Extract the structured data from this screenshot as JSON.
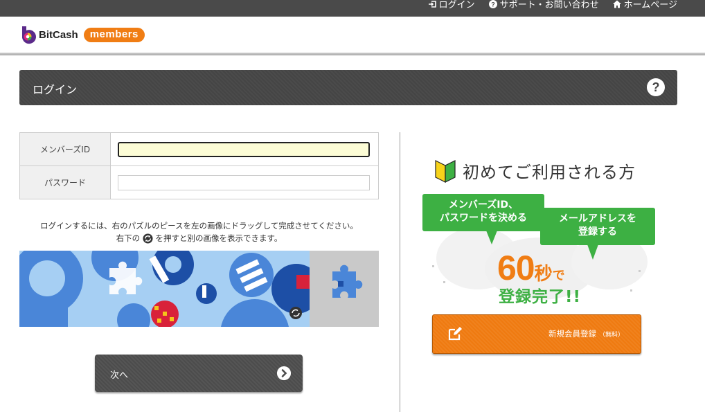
{
  "topbar": {
    "links": [
      {
        "label": "ログイン",
        "icon": "login-icon"
      },
      {
        "label": "サポート・お問い合わせ",
        "icon": "help-circle-icon"
      },
      {
        "label": "ホームページ",
        "icon": "home-icon"
      }
    ]
  },
  "header": {
    "brand": "BitCash",
    "badge": "members"
  },
  "titlebar": {
    "title": "ログイン",
    "help_label": "?"
  },
  "form": {
    "member_id_label": "メンバーズID",
    "member_id_value": "",
    "password_label": "パスワード",
    "password_value": ""
  },
  "instructions": {
    "line1": "ログインするには、右のパズルのピースを左の画像にドラッグして完成させてください。",
    "line2_before": "右下の",
    "line2_after": "を押すと別の画像を表示できます。"
  },
  "next_button": {
    "label": "次へ"
  },
  "new_registration": {
    "title": "初めてご利用される方",
    "bubble1": "メンバーズID、\nパスワードを決める",
    "bubble2": "メールアドレスを\n登録する",
    "big_number": "60",
    "big_unit": "秒",
    "big_suffix": "で",
    "complete_text": "登録完了!!",
    "button_label": "新規会員登録",
    "button_sub": "（無料）"
  },
  "colors": {
    "brand_orange": "#f07d14",
    "promo_green": "#3db043",
    "dark_bar": "#454545",
    "active_field_bg": "#fdfdd6"
  }
}
